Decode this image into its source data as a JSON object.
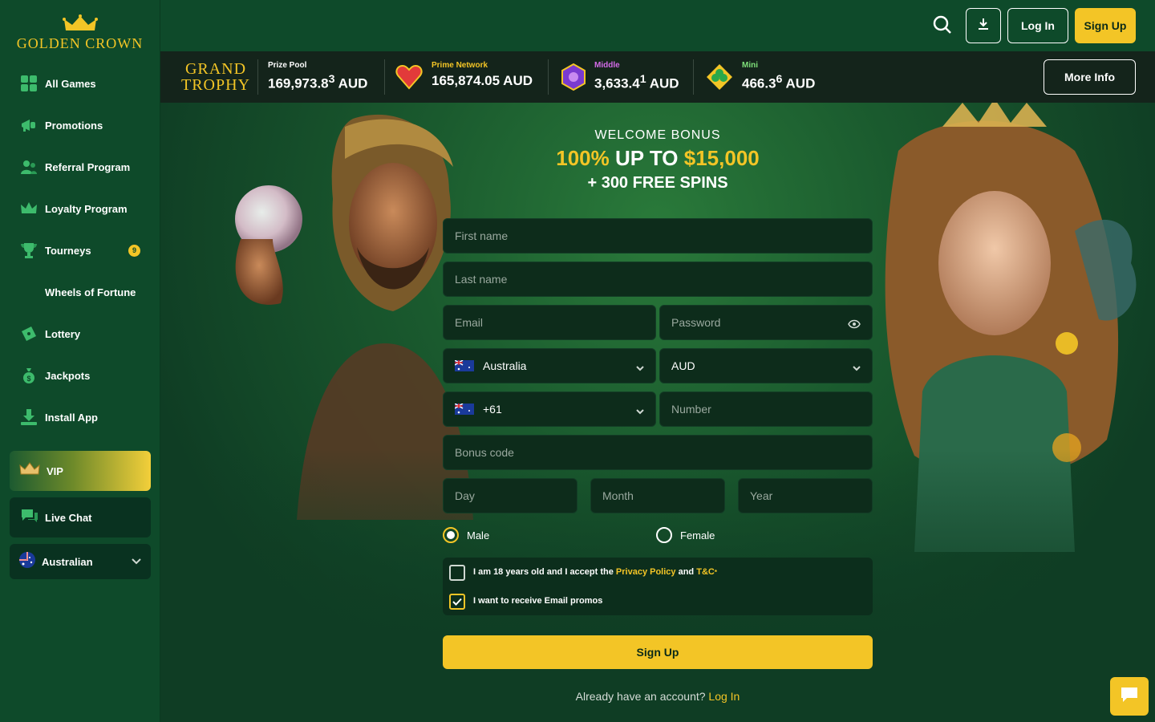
{
  "brand": {
    "name": "GOLDEN CROWN"
  },
  "sidebar": {
    "items": [
      {
        "label": "All Games",
        "icon": "grid-icon"
      },
      {
        "label": "Promotions",
        "icon": "megaphone-icon"
      },
      {
        "label": "Referral Program",
        "icon": "users-icon"
      },
      {
        "label": "Loyalty Program",
        "icon": "crown-icon"
      },
      {
        "label": "Tourneys",
        "icon": "trophy-icon",
        "badge": "9"
      },
      {
        "label": "Wheels of Fortune",
        "icon": ""
      },
      {
        "label": "Lottery",
        "icon": "ticket-icon"
      },
      {
        "label": "Jackpots",
        "icon": "money-bag-icon"
      },
      {
        "label": "Install App",
        "icon": "download-icon"
      }
    ],
    "vip_label": "VIP",
    "live_chat_label": "Live Chat",
    "language_label": "Australian"
  },
  "header": {
    "login_label": "Log In",
    "signup_label": "Sign Up"
  },
  "jackpot": {
    "grand_line1": "GRAND",
    "grand_line2": "TROPHY",
    "prize_pool_label": "Prize Pool",
    "prize_pool_main": "169,973.8",
    "prize_pool_sup": "3",
    "prize_pool_currency": "AUD",
    "prime_label": "Prime Network",
    "prime_value": "165,874.05 AUD",
    "middle_label": "Middle",
    "middle_main": "3,633.4",
    "middle_sup": "1",
    "middle_currency": "AUD",
    "mini_label": "Mini",
    "mini_main": "466.3",
    "mini_sup": "6",
    "mini_currency": "AUD",
    "more_info_label": "More Info",
    "colors": {
      "prime": "#f3c526",
      "middle": "#d36be8",
      "mini": "#7fe07a"
    }
  },
  "welcome": {
    "line1": "WELCOME BONUS",
    "pct": "100%",
    "up_to": "UP TO",
    "amount": "$15,000",
    "line3": "+ 300 FREE SPINS"
  },
  "form": {
    "first_name_placeholder": "First name",
    "last_name_placeholder": "Last name",
    "email_placeholder": "Email",
    "password_placeholder": "Password",
    "country_value": "Australia",
    "currency_value": "AUD",
    "phone_code_value": "+61",
    "number_placeholder": "Number",
    "bonus_code_placeholder": "Bonus code",
    "day_placeholder": "Day",
    "month_placeholder": "Month",
    "year_placeholder": "Year",
    "gender_male": "Male",
    "gender_female": "Female",
    "gender_selected": "Male",
    "consent_prefix": "I am 18 years old and I accept the",
    "consent_privacy": "Privacy Policy",
    "consent_and": "and",
    "consent_tc": "T&C",
    "consent_req": "*",
    "promos_label": "I want to receive Email promos",
    "promos_checked": true,
    "signup_label": "Sign Up",
    "already_text": "Already have an account?",
    "login_link": "Log In"
  },
  "colors": {
    "accent": "#f3c526",
    "bg": "#0f3d24",
    "sidebar": "#0e4a2a"
  }
}
